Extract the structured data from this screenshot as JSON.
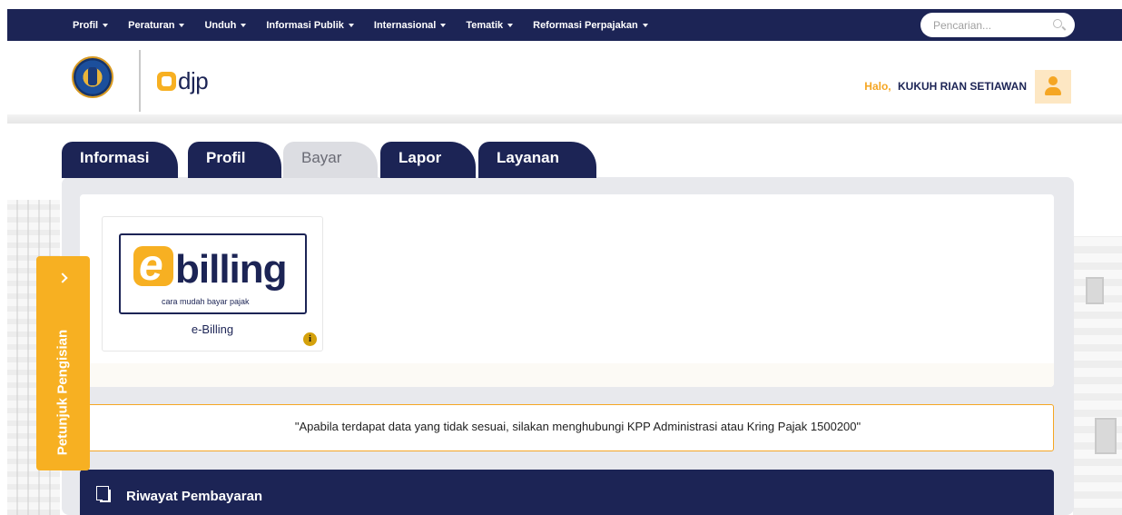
{
  "topnav": {
    "menu": [
      {
        "label": "Profil"
      },
      {
        "label": "Peraturan"
      },
      {
        "label": "Unduh"
      },
      {
        "label": "Informasi Publik"
      },
      {
        "label": "Internasional"
      },
      {
        "label": "Tematik"
      },
      {
        "label": "Reformasi Perpajakan"
      }
    ],
    "search": {
      "placeholder": "Pencarian..."
    }
  },
  "header": {
    "brand": "djp",
    "greeting": {
      "halo": "Halo,",
      "name": "KUKUH RIAN SETIAWAN"
    }
  },
  "tabs": [
    {
      "label": "Informasi"
    },
    {
      "label": "Profil"
    },
    {
      "label": "Bayar"
    },
    {
      "label": "Lapor"
    },
    {
      "label": "Layanan"
    }
  ],
  "services": {
    "ebilling": {
      "logo_word": "billing",
      "tagline": "cara mudah bayar pajak",
      "label": "e-Billing",
      "info_glyph": "i"
    }
  },
  "notice": "\"Apabila terdapat data yang tidak sesuai, silakan menghubungi KPP Administrasi atau Kring Pajak 1500200\"",
  "riwayat": {
    "title": "Riwayat Pembayaran"
  },
  "side_panel": {
    "label": "Petunjuk Pengisian"
  },
  "colors": {
    "navy": "#1c2455",
    "accent": "#f5a623",
    "tab_active": "#dcdde2"
  }
}
